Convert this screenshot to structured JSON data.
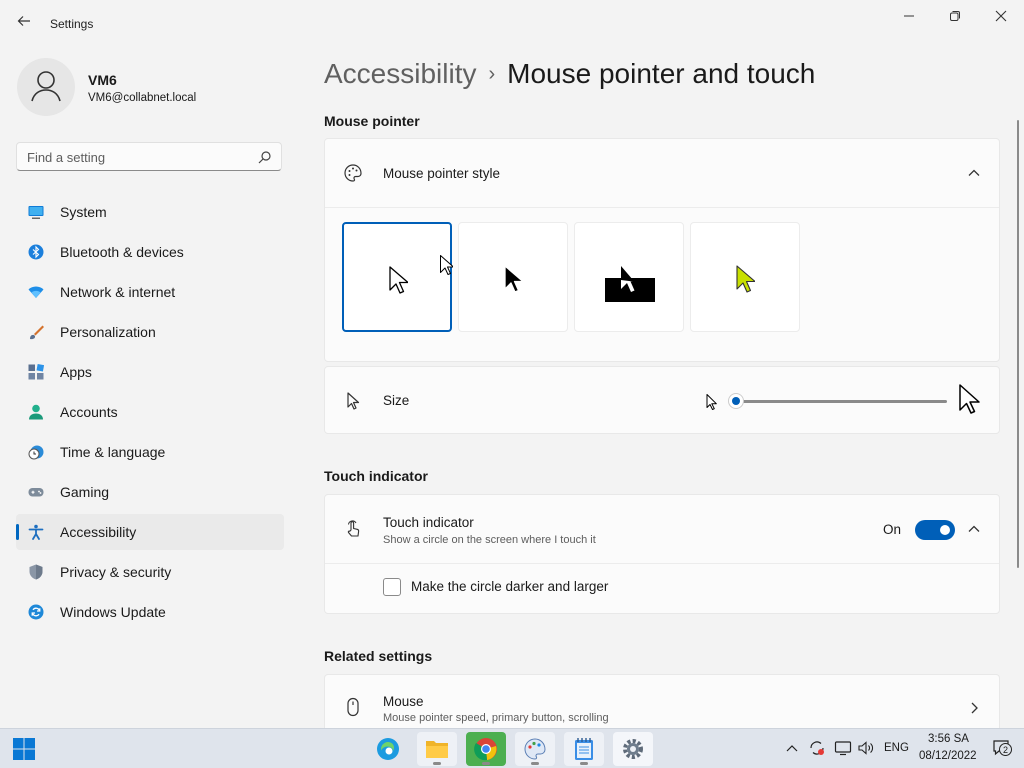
{
  "window": {
    "title": "Settings"
  },
  "user": {
    "name": "VM6",
    "email": "VM6@collabnet.local"
  },
  "search": {
    "placeholder": "Find a setting"
  },
  "nav": [
    {
      "label": "System",
      "icon": "system-icon",
      "active": false
    },
    {
      "label": "Bluetooth & devices",
      "icon": "bluetooth-icon",
      "active": false
    },
    {
      "label": "Network & internet",
      "icon": "wifi-icon",
      "active": false
    },
    {
      "label": "Personalization",
      "icon": "brush-icon",
      "active": false
    },
    {
      "label": "Apps",
      "icon": "apps-icon",
      "active": false
    },
    {
      "label": "Accounts",
      "icon": "person-icon",
      "active": false
    },
    {
      "label": "Time & language",
      "icon": "clock-globe-icon",
      "active": false
    },
    {
      "label": "Gaming",
      "icon": "gamepad-icon",
      "active": false
    },
    {
      "label": "Accessibility",
      "icon": "accessibility-icon",
      "active": true
    },
    {
      "label": "Privacy & security",
      "icon": "shield-icon",
      "active": false
    },
    {
      "label": "Windows Update",
      "icon": "update-icon",
      "active": false
    }
  ],
  "breadcrumb": {
    "parent": "Accessibility",
    "separator": "›",
    "current": "Mouse pointer and touch"
  },
  "mouse_pointer": {
    "section_title": "Mouse pointer",
    "style_label": "Mouse pointer style",
    "styles": [
      {
        "name": "white",
        "selected": true
      },
      {
        "name": "black",
        "selected": false
      },
      {
        "name": "inverted",
        "selected": false
      },
      {
        "name": "custom",
        "selected": false,
        "color": "#c8e000"
      }
    ],
    "size_label": "Size",
    "size_value": 1
  },
  "touch": {
    "section_title": "Touch indicator",
    "label": "Touch indicator",
    "description": "Show a circle on the screen where I touch it",
    "state_label": "On",
    "enabled": true,
    "option_label": "Make the circle darker and larger",
    "option_checked": false
  },
  "related": {
    "section_title": "Related settings",
    "mouse_label": "Mouse",
    "mouse_description": "Mouse pointer speed, primary button, scrolling"
  },
  "taskbar": {
    "apps": [
      "start-icon",
      "edge-icon",
      "file-explorer-icon",
      "chrome-icon",
      "paint-icon",
      "notepad-icon",
      "settings-icon"
    ],
    "language": "ENG",
    "time": "3:56 SA",
    "date": "08/12/2022",
    "notification_count": "2"
  },
  "colors": {
    "accent": "#005fb8",
    "background": "#f3f3f3",
    "card": "#fbfbfb"
  }
}
